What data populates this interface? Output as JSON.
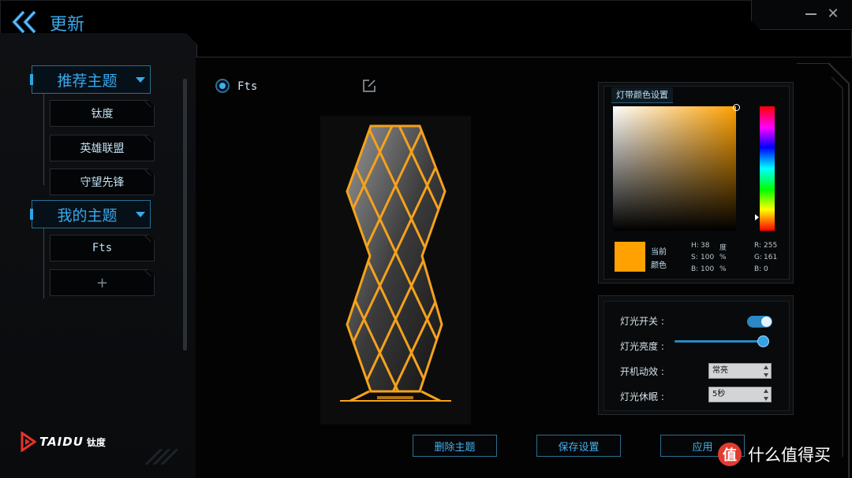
{
  "header": {
    "title": "更新"
  },
  "sidebar": {
    "groups": [
      {
        "label": "推荐主题",
        "items": [
          {
            "label": "钛度"
          },
          {
            "label": "英雄联盟"
          },
          {
            "label": "守望先锋"
          }
        ]
      },
      {
        "label": "我的主题",
        "items": [
          {
            "label": "Fts"
          },
          {
            "label": "+"
          }
        ]
      }
    ],
    "logo": {
      "word": "TAIDU",
      "cn": "钛度"
    }
  },
  "main": {
    "theme_radio_label": "Fts",
    "theme_selected": true
  },
  "color_picker": {
    "title": "灯带颜色设置",
    "current_label_1": "当前",
    "current_label_2": "颜色",
    "current_color": "#ffa100",
    "h_label": "H:",
    "h_value": "38",
    "h_unit": "度",
    "s_label": "S:",
    "s_value": "100",
    "s_unit": "%",
    "b_label": "B:",
    "b_value": "100",
    "b_unit": "%",
    "r_label": "R:",
    "r_value": "255",
    "g_label": "G:",
    "g_value": "161",
    "bb_label": "B:",
    "bb_value": "0"
  },
  "settings": {
    "light_switch_label": "灯光开关 :",
    "light_switch_on": true,
    "brightness_label": "灯光亮度 :",
    "brightness_fraction": 1.0,
    "boot_effect_label": "开机动效 :",
    "boot_effect_value": "常亮",
    "sleep_label": "灯光休眠 :",
    "sleep_value": "5秒"
  },
  "buttons": {
    "delete": "删除主题",
    "save": "保存设置",
    "apply": "应用"
  },
  "watermark": {
    "badge": "值",
    "text": "什么值得买"
  },
  "colors": {
    "accent": "#39a9ea",
    "lamp": "#ffa100"
  }
}
